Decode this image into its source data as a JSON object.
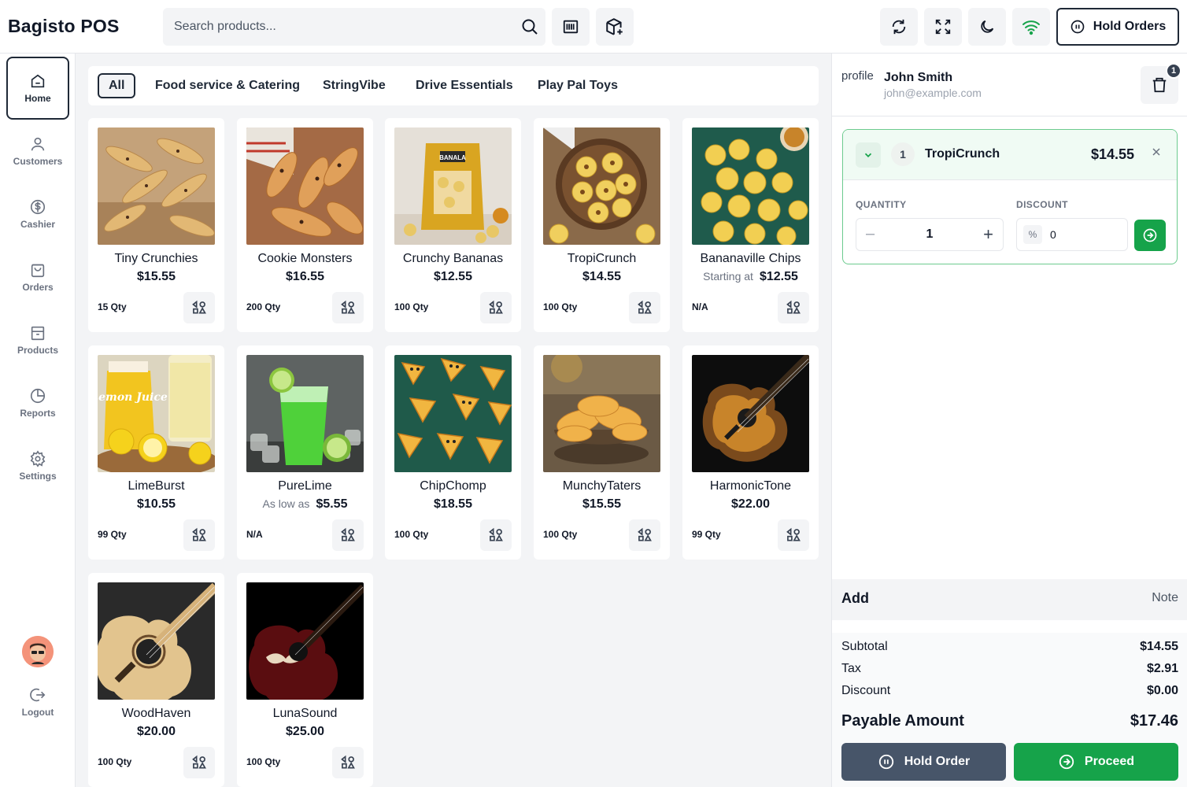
{
  "app": {
    "title": "Bagisto POS"
  },
  "search": {
    "placeholder": "Search products..."
  },
  "header": {
    "hold_orders_label": "Hold Orders"
  },
  "sidebar": {
    "items": [
      {
        "label": "Home",
        "icon": "home-icon",
        "active": true
      },
      {
        "label": "Customers",
        "icon": "user-icon"
      },
      {
        "label": "Cashier",
        "icon": "dollar-icon"
      },
      {
        "label": "Orders",
        "icon": "bag-icon"
      },
      {
        "label": "Products",
        "icon": "box-icon"
      },
      {
        "label": "Reports",
        "icon": "pie-chart-icon"
      },
      {
        "label": "Settings",
        "icon": "gear-icon"
      }
    ],
    "logout_label": "Logout"
  },
  "categories": [
    "All",
    "Food service & Catering",
    "StringVibe",
    "Drive Essentials",
    "Play Pal Toys"
  ],
  "products": [
    {
      "name": "Tiny Crunchies",
      "price": "$15.55",
      "price_prefix": "",
      "qty": "15 Qty"
    },
    {
      "name": "Cookie Monsters",
      "price": "$16.55",
      "price_prefix": "",
      "qty": "200 Qty"
    },
    {
      "name": "Crunchy Bananas",
      "price": "$12.55",
      "price_prefix": "",
      "qty": "100 Qty",
      "package_text": "BANALA"
    },
    {
      "name": "TropiCrunch",
      "price": "$14.55",
      "price_prefix": "",
      "qty": "100 Qty"
    },
    {
      "name": "Bananaville Chips",
      "price": "$12.55",
      "price_prefix": "Starting at",
      "qty": "N/A"
    },
    {
      "name": "LimeBurst",
      "price": "$10.55",
      "price_prefix": "",
      "qty": "99 Qty",
      "package_text": "Lemon Juice"
    },
    {
      "name": "PureLime",
      "price": "$5.55",
      "price_prefix": "As low as",
      "qty": "N/A"
    },
    {
      "name": "ChipChomp",
      "price": "$18.55",
      "price_prefix": "",
      "qty": "100 Qty"
    },
    {
      "name": "MunchyTaters",
      "price": "$15.55",
      "price_prefix": "",
      "qty": "100 Qty"
    },
    {
      "name": "HarmonicTone",
      "price": "$22.00",
      "price_prefix": "",
      "qty": "99 Qty"
    },
    {
      "name": "WoodHaven",
      "price": "$20.00",
      "price_prefix": "",
      "qty": "100 Qty"
    },
    {
      "name": "LunaSound",
      "price": "$25.00",
      "price_prefix": "",
      "qty": "100 Qty"
    }
  ],
  "customer": {
    "avatar_alt": "profile",
    "name": "John Smith",
    "email": "john@example.com",
    "cart_count": "1"
  },
  "cart": {
    "item": {
      "index": "1",
      "name": "TropiCrunch",
      "price": "$14.55",
      "quantity_label": "QUANTITY",
      "discount_label": "DISCOUNT",
      "quantity": "1",
      "discount_symbol": "%",
      "discount_value": "0"
    }
  },
  "note": {
    "add_label": "Add",
    "note_label": "Note"
  },
  "totals": {
    "subtotal_label": "Subtotal",
    "subtotal": "$14.55",
    "tax_label": "Tax",
    "tax": "$2.91",
    "discount_label": "Discount",
    "discount": "$0.00",
    "payable_label": "Payable Amount",
    "payable": "$17.46"
  },
  "actions": {
    "hold_label": "Hold Order",
    "proceed_label": "Proceed"
  },
  "colors": {
    "accent_green": "#16a34a",
    "dark": "#1f2937",
    "hold_button": "#475569",
    "wifi_green": "#16a34a"
  }
}
